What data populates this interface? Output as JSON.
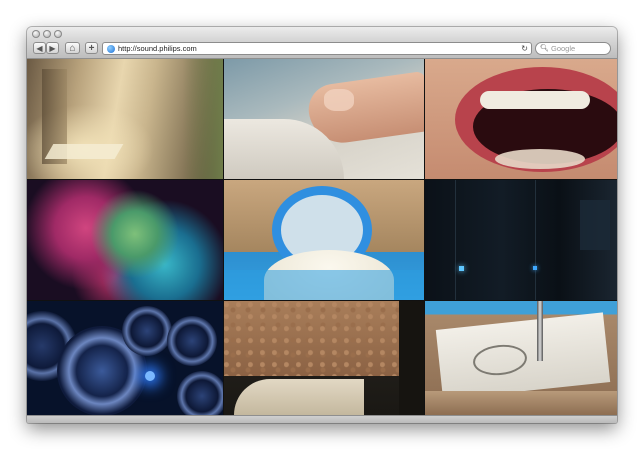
{
  "browser": {
    "url": "http://sound.philips.com",
    "search_placeholder": "Google",
    "back_glyph": "◀",
    "forward_glyph": "▶",
    "home_glyph": "⌂",
    "add_glyph": "+",
    "reload_glyph": "↻",
    "search_glyph": "🔍︎"
  },
  "tiles": [
    {
      "name": "tile-light-room",
      "subject": "wooden corner in sunlight"
    },
    {
      "name": "tile-finger",
      "subject": "fingertip touching surface"
    },
    {
      "name": "tile-mouth",
      "subject": "open mouth with teeth"
    },
    {
      "name": "tile-ink-cloud",
      "subject": "colorful ink cloud"
    },
    {
      "name": "tile-speaker-part",
      "subject": "blue speaker component with white cone"
    },
    {
      "name": "tile-dark-lights",
      "subject": "dark room with blue lights"
    },
    {
      "name": "tile-speakers",
      "subject": "array of blue speakers"
    },
    {
      "name": "tile-cork",
      "subject": "cork block close-up"
    },
    {
      "name": "tile-stamp",
      "subject": "stamped document with pen"
    }
  ]
}
